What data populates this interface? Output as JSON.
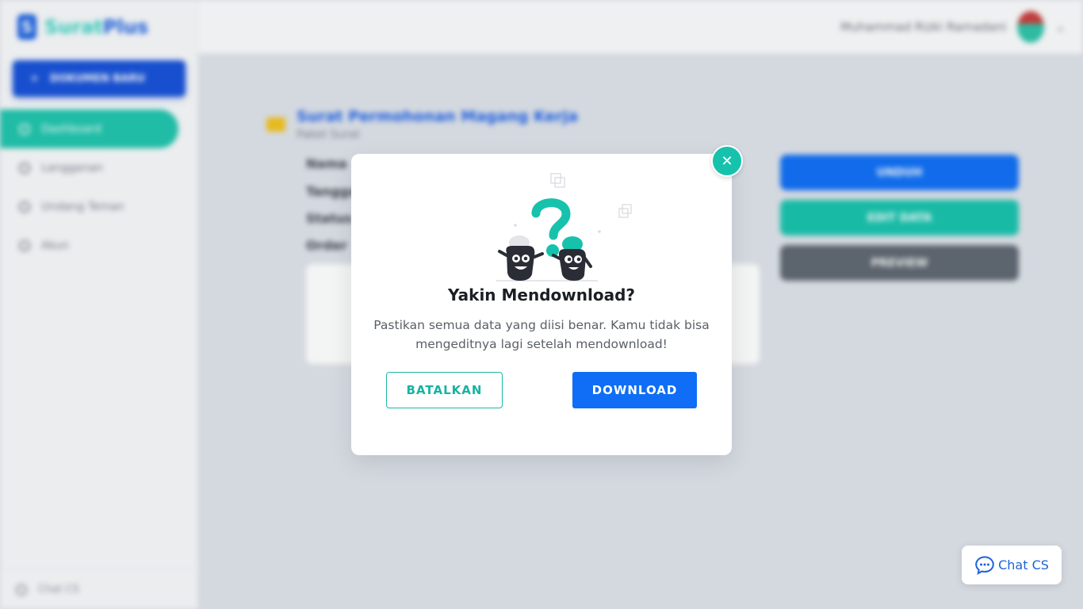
{
  "app": {
    "brand": {
      "logo_mark": "S",
      "name_part1": "Surat",
      "name_part2": "Plus"
    },
    "new_document_label": "DOKUMEN BARU",
    "nav_items": [
      {
        "label": "Dashboard",
        "icon": "home-icon",
        "active": true
      },
      {
        "label": "Langganan",
        "icon": "globe-icon",
        "active": false
      },
      {
        "label": "Undang Teman",
        "icon": "user-plus-icon",
        "active": false
      },
      {
        "label": "Akun",
        "icon": "user-icon",
        "active": false
      }
    ],
    "footer_label": "Chat CS",
    "user_name": "Muhammad Rizki Ramadani",
    "document": {
      "title": "Surat Permohonan Magang Kerja",
      "category": "Paket Surat",
      "fields": [
        "Nama",
        "Tanggal",
        "Status",
        "Order"
      ]
    },
    "actions": {
      "unduh": "UNDUH",
      "edit": "EDIT DATA",
      "preview": "PREVIEW"
    },
    "colors": {
      "primary": "#0f6ef5",
      "accent": "#17c2ad",
      "muted_button": "#5f6670"
    }
  },
  "modal": {
    "close_icon": "close-icon",
    "title": "Yakin Mendownload?",
    "message": "Pastikan semua data yang diisi benar. Kamu tidak bisa mengeditnya lagi setelah mendownload!",
    "cancel_label": "BATALKAN",
    "confirm_label": "DOWNLOAD"
  },
  "chat_widget": {
    "label": "Chat CS",
    "icon": "chat-bubble-icon"
  }
}
